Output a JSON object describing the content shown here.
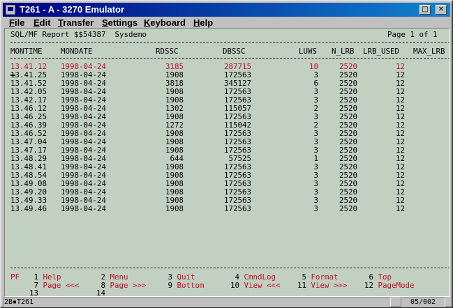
{
  "window": {
    "title": "T261 - A - 3270 Emulator",
    "minimize_glyph": "□",
    "close_glyph": "✕"
  },
  "menu": [
    "File",
    "Edit",
    "Transfer",
    "Settings",
    "Keyboard",
    "Help"
  ],
  "menu_underline": [
    "F",
    "E",
    "T",
    "S",
    "K",
    "H"
  ],
  "report": {
    "header_left": "SQL/MF Report $$54387  Sysdemo",
    "header_right": "Page 1 of 1",
    "columns": [
      "MONTIME",
      "MONDATE",
      "RDSSC",
      "DBSSC",
      "LUWS",
      "N_LRB",
      "LRB_USED",
      "MAX_LRB"
    ],
    "rows": [
      [
        "13.41.12",
        "1998-04-24",
        "3185",
        "287715",
        "10",
        "2520",
        "12"
      ],
      [
        "13.41.25",
        "1998-04-24",
        "1908",
        "172563",
        "3",
        "2520",
        "12"
      ],
      [
        "13.41.52",
        "1998-04-24",
        "3818",
        "345127",
        "6",
        "2520",
        "12"
      ],
      [
        "13.42.05",
        "1998-04-24",
        "1908",
        "172563",
        "3",
        "2520",
        "12"
      ],
      [
        "13.42.17",
        "1998-04-24",
        "1908",
        "172563",
        "3",
        "2520",
        "12"
      ],
      [
        "13.46.12",
        "1998-04-24",
        "1302",
        "115057",
        "2",
        "2520",
        "12"
      ],
      [
        "13.46.25",
        "1998-04-24",
        "1908",
        "172563",
        "3",
        "2520",
        "12"
      ],
      [
        "13.46.39",
        "1998-04-24",
        "1272",
        "115042",
        "2",
        "2520",
        "12"
      ],
      [
        "13.46.52",
        "1998-04-24",
        "1908",
        "172563",
        "3",
        "2520",
        "12"
      ],
      [
        "13.47.04",
        "1998-04-24",
        "1908",
        "172563",
        "3",
        "2520",
        "12"
      ],
      [
        "13.47.17",
        "1998-04-24",
        "1908",
        "172563",
        "3",
        "2520",
        "12"
      ],
      [
        "13.48.29",
        "1998-04-24",
        "644",
        "57525",
        "1",
        "2520",
        "12"
      ],
      [
        "13.48.41",
        "1998-04-24",
        "1908",
        "172563",
        "3",
        "2520",
        "12"
      ],
      [
        "13.48.54",
        "1998-04-24",
        "1908",
        "172563",
        "3",
        "2520",
        "12"
      ],
      [
        "13.49.08",
        "1998-04-24",
        "1908",
        "172563",
        "3",
        "2520",
        "12"
      ],
      [
        "13.49.20",
        "1998-04-24",
        "1908",
        "172563",
        "3",
        "2520",
        "12"
      ],
      [
        "13.49.33",
        "1998-04-24",
        "1908",
        "172563",
        "3",
        "2520",
        "12"
      ],
      [
        "13.49.46",
        "1998-04-24",
        "1908",
        "172563",
        "3",
        "2520",
        "12"
      ]
    ]
  },
  "pf_keys": {
    "prefix": "PF",
    "row1": [
      {
        "num": "1",
        "label": "Help"
      },
      {
        "num": "2",
        "label": "Menu"
      },
      {
        "num": "3",
        "label": "Quit"
      },
      {
        "num": "4",
        "label": "CmndLog"
      },
      {
        "num": "5",
        "label": "Format"
      },
      {
        "num": "6",
        "label": "Top"
      }
    ],
    "row2": [
      {
        "num": "7",
        "label": "Page <<<"
      },
      {
        "num": "8",
        "label": "Page >>>"
      },
      {
        "num": "9",
        "label": "Bottom"
      },
      {
        "num": "10",
        "label": "View <<<"
      },
      {
        "num": "11",
        "label": "View >>>"
      },
      {
        "num": "12",
        "label": "PageMode"
      }
    ],
    "row3": [
      {
        "num": "13",
        "label": ""
      },
      {
        "num": "14",
        "label": ""
      }
    ]
  },
  "status": {
    "left": "2B▪T261",
    "right": "05/002"
  },
  "colors": {
    "screen_bg": "#c2d0c2",
    "highlight": "#c0102a",
    "titlebar": "#000080"
  }
}
